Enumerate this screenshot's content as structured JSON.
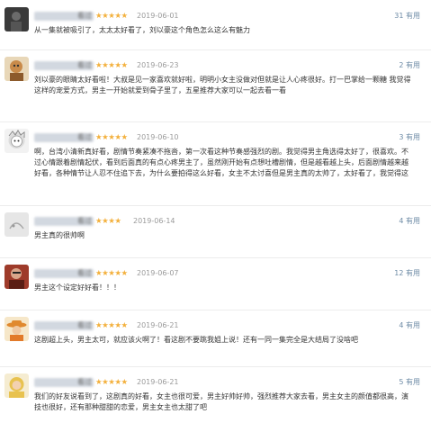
{
  "reviews": [
    {
      "username": "看过",
      "stars": "★★★★★",
      "date": "2019-06-01",
      "useful": "31 有用",
      "content": "从一集就被吸引了，太太太好看了，刘以豪这个角色怎么这么有魅力",
      "avatar": "dark-figure"
    },
    {
      "username": "看过",
      "stars": "★★★★★",
      "date": "2019-06-23",
      "useful": "2 有用",
      "content": "刘以豪的眼睛太好看啦！大叔是见一家喜欢就好啦，明明小女主没做对但就是让人心疼很好。打一巴掌给一颗糖 我觉得这样的宠爱方式，男主一开始就爱到骨子里了，五星推荐大家可以一起去看一看",
      "avatar": "cartoon"
    },
    {
      "username": "看过",
      "stars": "★★★★★",
      "date": "2019-06-10",
      "useful": "3 有用",
      "content": "啊，台湾小清新真好看，剧情节奏紧凑不拖沓，第一次看这种节奏感强烈的剧。我觉得男主角选得太好了，很喜欢。不过心情跟着剧情起伏，看到后面真的有点心疼男主了，虽然刚开始有点想吐槽剧情，但是越看越上头，后面剧情越来越好看，各种情节让人忍不住追下去，为什么要拍得这么好看，女主不太讨喜但是男主真的太帅了，太好看了，我觉得这部剧是真的好看，男女主角的演技都可以，值得推荐给大家去看一看。",
      "avatar": "anime"
    },
    {
      "username": "看过",
      "stars": "★★★★",
      "date": "2019-06-14",
      "useful": "4 有用",
      "content": "男主真的很帅啊",
      "avatar": "grey"
    },
    {
      "username": "看过",
      "stars": "★★★★★",
      "date": "2019-06-07",
      "useful": "12 有用",
      "content": "男主这个设定好好看！！！",
      "avatar": "red-figure"
    },
    {
      "username": "看过",
      "stars": "★★★★★",
      "date": "2019-06-21",
      "useful": "4 有用",
      "content": "这剧超上头，男主太可，就应该火啊了！看这剧不要跳我姐上说！还有一同一集完全是大结局了没啥吧",
      "avatar": "orange-hat"
    },
    {
      "username": "看过",
      "stars": "★★★★★",
      "date": "2019-06-21",
      "useful": "5 有用",
      "content": "我们的好友说看到了，这剧真的好看，女主也很可爱，男主好帅好帅，强烈推荐大家去看，男主女主的颜值都很高，演技也很好，还有那种甜甜的恋爱，男主女主也太甜了吧",
      "avatar": "blonde"
    }
  ]
}
